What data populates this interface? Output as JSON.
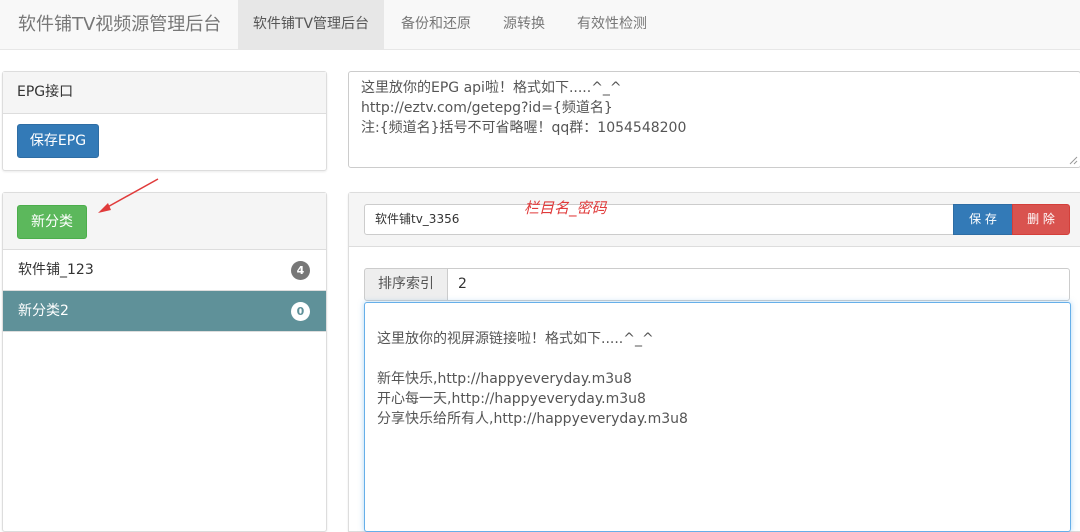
{
  "navbar": {
    "brand": "软件铺TV视频源管理后台",
    "tabs": [
      {
        "label": "软件铺TV管理后台",
        "active": true
      },
      {
        "label": "备份和还原"
      },
      {
        "label": "源转换"
      },
      {
        "label": "有效性检测"
      }
    ]
  },
  "epg_panel": {
    "heading": "EPG接口",
    "save_button": "保存EPG",
    "textarea": "这里放你的EPG api啦！格式如下.....^_^\nhttp://eztv.com/getepg?id={频道名}\n注:{频道名}括号不可省略喔！qq群：1054548200"
  },
  "category_panel": {
    "new_button": "新分类",
    "items": [
      {
        "label": "软件铺_123",
        "count": "4"
      },
      {
        "label": "新分类2",
        "count": "0",
        "active": true
      }
    ]
  },
  "channel_editor": {
    "name_value": "软件铺tv_3356",
    "annotation": "栏目名_密码",
    "save_button": "保 存",
    "delete_button": "删 除",
    "sort_label": "排序索引",
    "sort_value": "2",
    "sources_text": "这里放你的视屏源链接啦！格式如下.....^_^\n\n新年快乐,http://happyeveryday.m3u8\n开心每一天,http://happyeveryday.m3u8\n分享快乐给所有人,http://happyeveryday.m3u8"
  },
  "colors": {
    "primary": "#337ab7",
    "success": "#5cb85c",
    "danger": "#d9534f",
    "active_item": "#5f9199",
    "annotation_red": "#e03b3b"
  }
}
